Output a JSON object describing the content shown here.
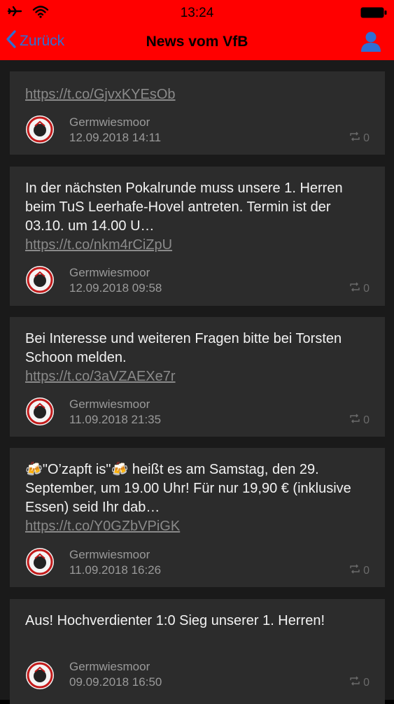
{
  "status_bar": {
    "time": "13:24"
  },
  "nav": {
    "back_label": "Zurück",
    "title": "News vom VfB"
  },
  "posts": [
    {
      "text": "",
      "link": "https://t.co/GjvxKYEsOb",
      "author": "Germwiesmoor",
      "date": "12.09.2018 14:11",
      "retweets": "0"
    },
    {
      "text": "In der nächsten Pokalrunde muss unsere 1. Herren beim TuS Leerhafe-Hovel antreten. Termin ist der 03.10. um 14.00 U…",
      "link": "https://t.co/nkm4rCiZpU",
      "author": "Germwiesmoor",
      "date": "12.09.2018 09:58",
      "retweets": "0"
    },
    {
      "text": "Bei Interesse und weiteren Fragen bitte bei Torsten Schoon melden.",
      "link": "https://t.co/3aVZAEXe7r",
      "author": "Germwiesmoor",
      "date": "11.09.2018 21:35",
      "retweets": "0"
    },
    {
      "text": "🍻\"O’zapft is\"🍻 heißt es am Samstag, den 29. September, um 19.00 Uhr! Für nur 19,90 € (inklusive Essen) seid Ihr dab…",
      "link": "https://t.co/Y0GZbVPiGK",
      "author": "Germwiesmoor",
      "date": "11.09.2018 16:26",
      "retweets": "0"
    },
    {
      "text": "Aus! Hochverdienter 1:0 Sieg unserer 1. Herren!",
      "link": "",
      "author": "Germwiesmoor",
      "date": "09.09.2018 16:50",
      "retweets": "0"
    }
  ],
  "colors": {
    "bar": "#ff0000",
    "accent": "#2f6fd4",
    "card": "#2c2c2c",
    "feed": "#1a1a1a"
  }
}
